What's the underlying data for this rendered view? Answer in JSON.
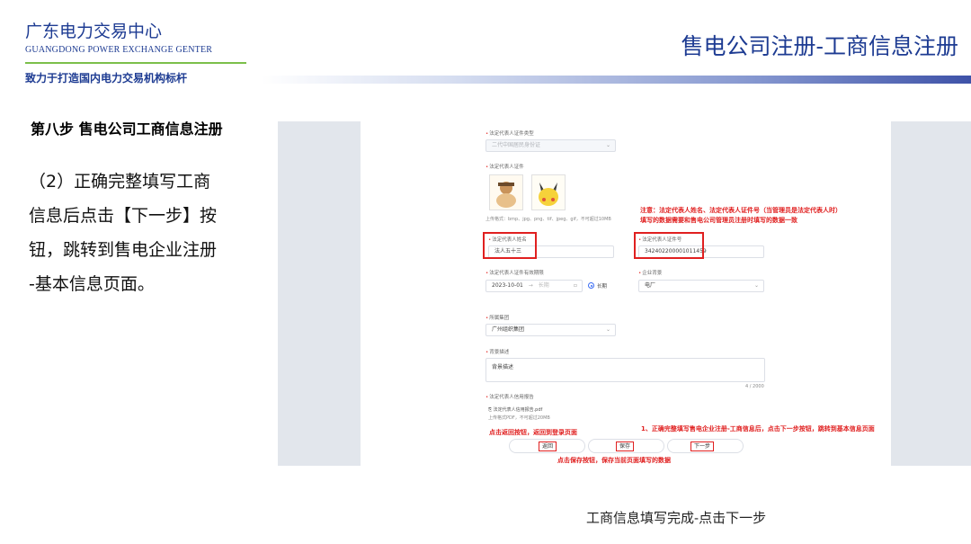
{
  "header": {
    "org_name": "广东电力交易中心",
    "org_name_en": "GUANGDONG POWER EXCHANGE GENTER",
    "motto": "致力于打造国内电力交易机构标杆",
    "slide_title": "售电公司注册-工商信息注册"
  },
  "left": {
    "step_title": "第八步 售电公司工商信息注册",
    "desc_lines": [
      "（2）正确完整填写工商",
      "信息后点击【下一步】按",
      "钮，跳转到售电企业注册",
      "-基本信息页面。"
    ]
  },
  "form": {
    "id_type_label": "法定代表人证件类型",
    "id_type_value": "二代中国居民身份证",
    "id_photo_label": "法定代表人证件",
    "upload_hint": "上传格式：bmp、jpg、png、tif、jpeg、gif，不可超过10MB",
    "rep_name_label": "法定代表人姓名",
    "rep_name_value": "法人五十三",
    "rep_id_label": "法定代表人证件号",
    "rep_id_value": "342402200001011459",
    "validity_label": "法定代表人证件有效期限",
    "validity_start": "2023-10-01",
    "validity_sep": "→",
    "validity_end_placeholder": "长期",
    "long_term_label": "长期",
    "enterprise_bg_label": "企业背景",
    "enterprise_bg_value": "电厂",
    "group_label": "所属集团",
    "group_value": "广州组织集团",
    "bg_desc_label": "背景描述",
    "bg_desc_value": "背景描述",
    "char_count": "4 / 2000",
    "credit_label": "法定代表人信用报告",
    "credit_file": "法定代表人信用报告.pdf",
    "credit_hint": "上传格式PDF，不可超过20MB",
    "btn_back": "返回",
    "btn_save": "保存",
    "btn_next": "下一步"
  },
  "annotations": {
    "note_line1": "注意：法定代表人姓名、法定代表人证件号（当管理员是法定代表人时）",
    "note_line2": "填写的数据需要和售电公司管理员注册时填写的数据一致",
    "back_note": "点击返回按钮，返回到登录页面",
    "next_note": "1、正确完整填写售电企业注册-工商信息后，点击下一步按钮，跳转到基本信息页面",
    "save_note": "点击保存按钮，保存当前页面填写的数据"
  },
  "footer": {
    "caption": "工商信息填写完成-点击下一步"
  },
  "colors": {
    "brand_blue": "#1d3b92",
    "accent_green": "#7bbf4a",
    "annotation_red": "#e02020",
    "panel_bg": "#e2e6ec"
  }
}
